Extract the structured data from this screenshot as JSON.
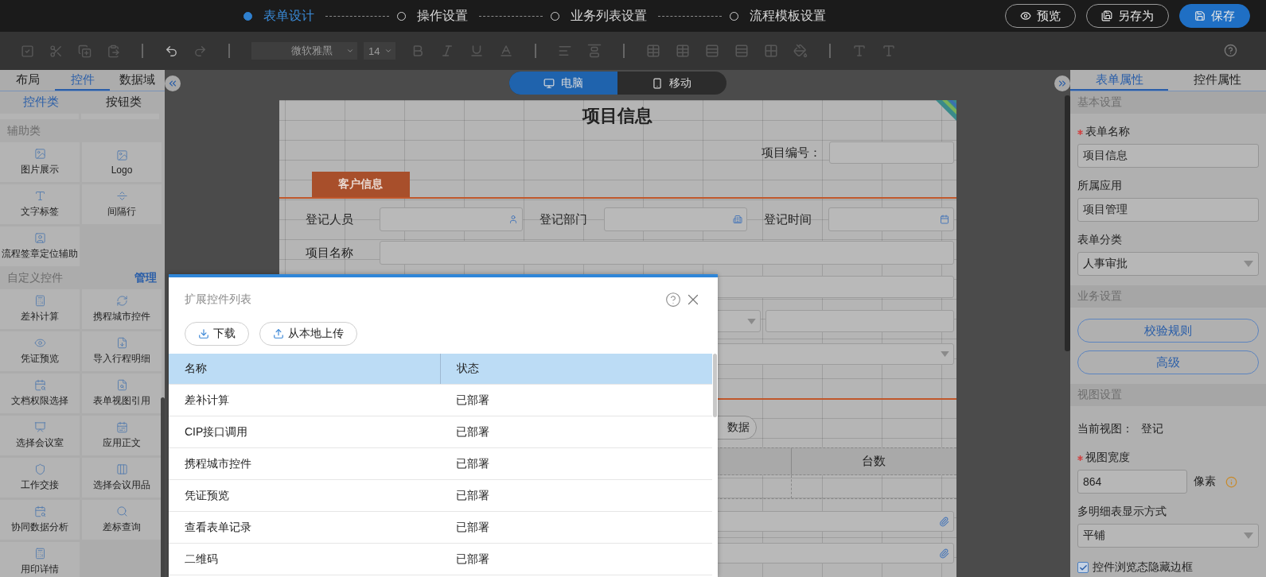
{
  "steps": [
    {
      "label": "表单设计",
      "selected": true
    },
    {
      "label": "操作设置",
      "selected": false
    },
    {
      "label": "业务列表设置",
      "selected": false
    },
    {
      "label": "流程模板设置",
      "selected": false
    }
  ],
  "header_buttons": [
    {
      "label": "预览",
      "kind": "preview"
    },
    {
      "label": "另存为",
      "kind": "saveas"
    },
    {
      "label": "保存",
      "kind": "save"
    }
  ],
  "toolbar": {
    "font": "微软雅黑",
    "size": "14"
  },
  "left_panel": {
    "tabs": [
      {
        "label": "布局",
        "selected": false
      },
      {
        "label": "控件",
        "selected": true
      },
      {
        "label": "数据域",
        "selected": false
      }
    ],
    "subtabs": [
      {
        "label": "控件类",
        "selected": true
      },
      {
        "label": "按钮类",
        "selected": false
      }
    ],
    "groups": [
      {
        "title": "辅助类",
        "items": [
          "图片展示",
          "Logo",
          "文字标签",
          "间隔行",
          "流程签章定位辅助"
        ]
      },
      {
        "title": "自定义控件",
        "action": "管理",
        "items": [
          "差补计算",
          "携程城市控件",
          "凭证预览",
          "导入行程明细",
          "文档权限选择",
          "表单视图引用",
          "选择会议室",
          "应用正文",
          "工作交接",
          "选择会议用品",
          "协同数据分析",
          "差标查询",
          "用印详情"
        ]
      }
    ]
  },
  "view_toggle": [
    {
      "label": "电脑",
      "kind": "desktop",
      "selected": true
    },
    {
      "label": "移动",
      "kind": "mobile",
      "selected": false
    }
  ],
  "form": {
    "title": "项目信息",
    "number_label": "项目编号：",
    "section": "客户信息",
    "register_fields": [
      {
        "label": "登记人员",
        "kind": "user"
      },
      {
        "label": "登记部门",
        "kind": "department"
      },
      {
        "label": "登记时间",
        "kind": "date"
      }
    ],
    "name_label": "项目名称",
    "partial_button": "数据",
    "table_header": "台数"
  },
  "right_panel": {
    "tabs": [
      {
        "label": "表单属性",
        "selected": true
      },
      {
        "label": "控件属性",
        "selected": false
      }
    ],
    "sections": [
      {
        "title": "基本设置",
        "rows": [
          {
            "kind": "input",
            "label": "表单名称",
            "required": true,
            "value": "项目信息"
          },
          {
            "kind": "input",
            "label": "所属应用",
            "required": false,
            "value": "项目管理"
          },
          {
            "kind": "select",
            "label": "表单分类",
            "required": false,
            "value": "人事审批"
          }
        ]
      },
      {
        "title": "业务设置",
        "rows": [
          {
            "kind": "button",
            "label": "校验规则"
          },
          {
            "kind": "button",
            "label": "高级"
          }
        ]
      },
      {
        "title": "视图设置",
        "rows": [
          {
            "kind": "info",
            "label": "当前视图：",
            "value": "登记"
          },
          {
            "kind": "unit-input",
            "label": "视图宽度",
            "required": true,
            "value": "864",
            "unit": "像素"
          },
          {
            "kind": "select",
            "label": "多明细表显示方式",
            "required": false,
            "value": "平铺"
          },
          {
            "kind": "checkbox",
            "label": "控件浏览态隐藏边框",
            "checked": true
          }
        ]
      }
    ]
  },
  "dialog": {
    "title": "扩展控件列表",
    "buttons": [
      {
        "label": "下载",
        "kind": "download"
      },
      {
        "label": "从本地上传",
        "kind": "upload"
      }
    ],
    "columns": [
      "名称",
      "状态"
    ],
    "rows": [
      [
        "差补计算",
        "已部署"
      ],
      [
        "CIP接口调用",
        "已部署"
      ],
      [
        "携程城市控件",
        "已部署"
      ],
      [
        "凭证预览",
        "已部署"
      ],
      [
        "查看表单记录",
        "已部署"
      ],
      [
        "二维码",
        "已部署"
      ]
    ]
  }
}
